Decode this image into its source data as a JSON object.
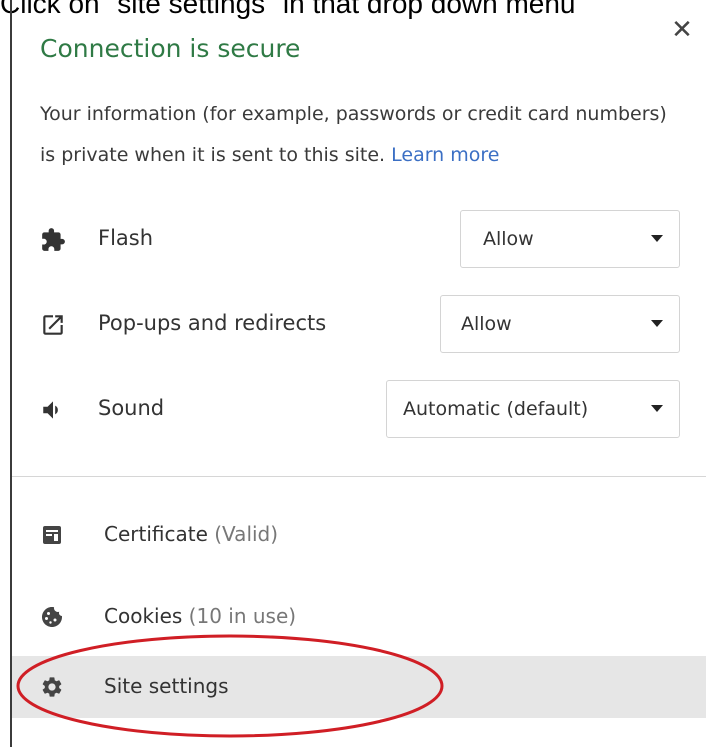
{
  "caption": "Click on \"site settings\" in that drop down menu",
  "popup": {
    "close_label": "✕",
    "title": "Connection is secure",
    "description": "Your information (for example, passwords or credit card numbers) is private when it is sent to this site.",
    "learn_more": "Learn more",
    "permissions": [
      {
        "icon": "puzzle-icon",
        "label": "Flash",
        "value": "Allow"
      },
      {
        "icon": "popup-redirect-icon",
        "label": "Pop-ups and redirects",
        "value": "Allow"
      },
      {
        "icon": "speaker-icon",
        "label": "Sound",
        "value": "Automatic (default)"
      }
    ],
    "menu": [
      {
        "icon": "certificate-icon",
        "label": "Certificate",
        "sub": "(Valid)"
      },
      {
        "icon": "cookie-icon",
        "label": "Cookies",
        "sub": "(10 in use)"
      },
      {
        "icon": "gear-icon",
        "label": "Site settings",
        "sub": ""
      }
    ]
  },
  "colors": {
    "title": "#2f7a45",
    "link": "#3b6fc4",
    "highlight": "#e6e6e6",
    "annotation": "#d01e25"
  }
}
